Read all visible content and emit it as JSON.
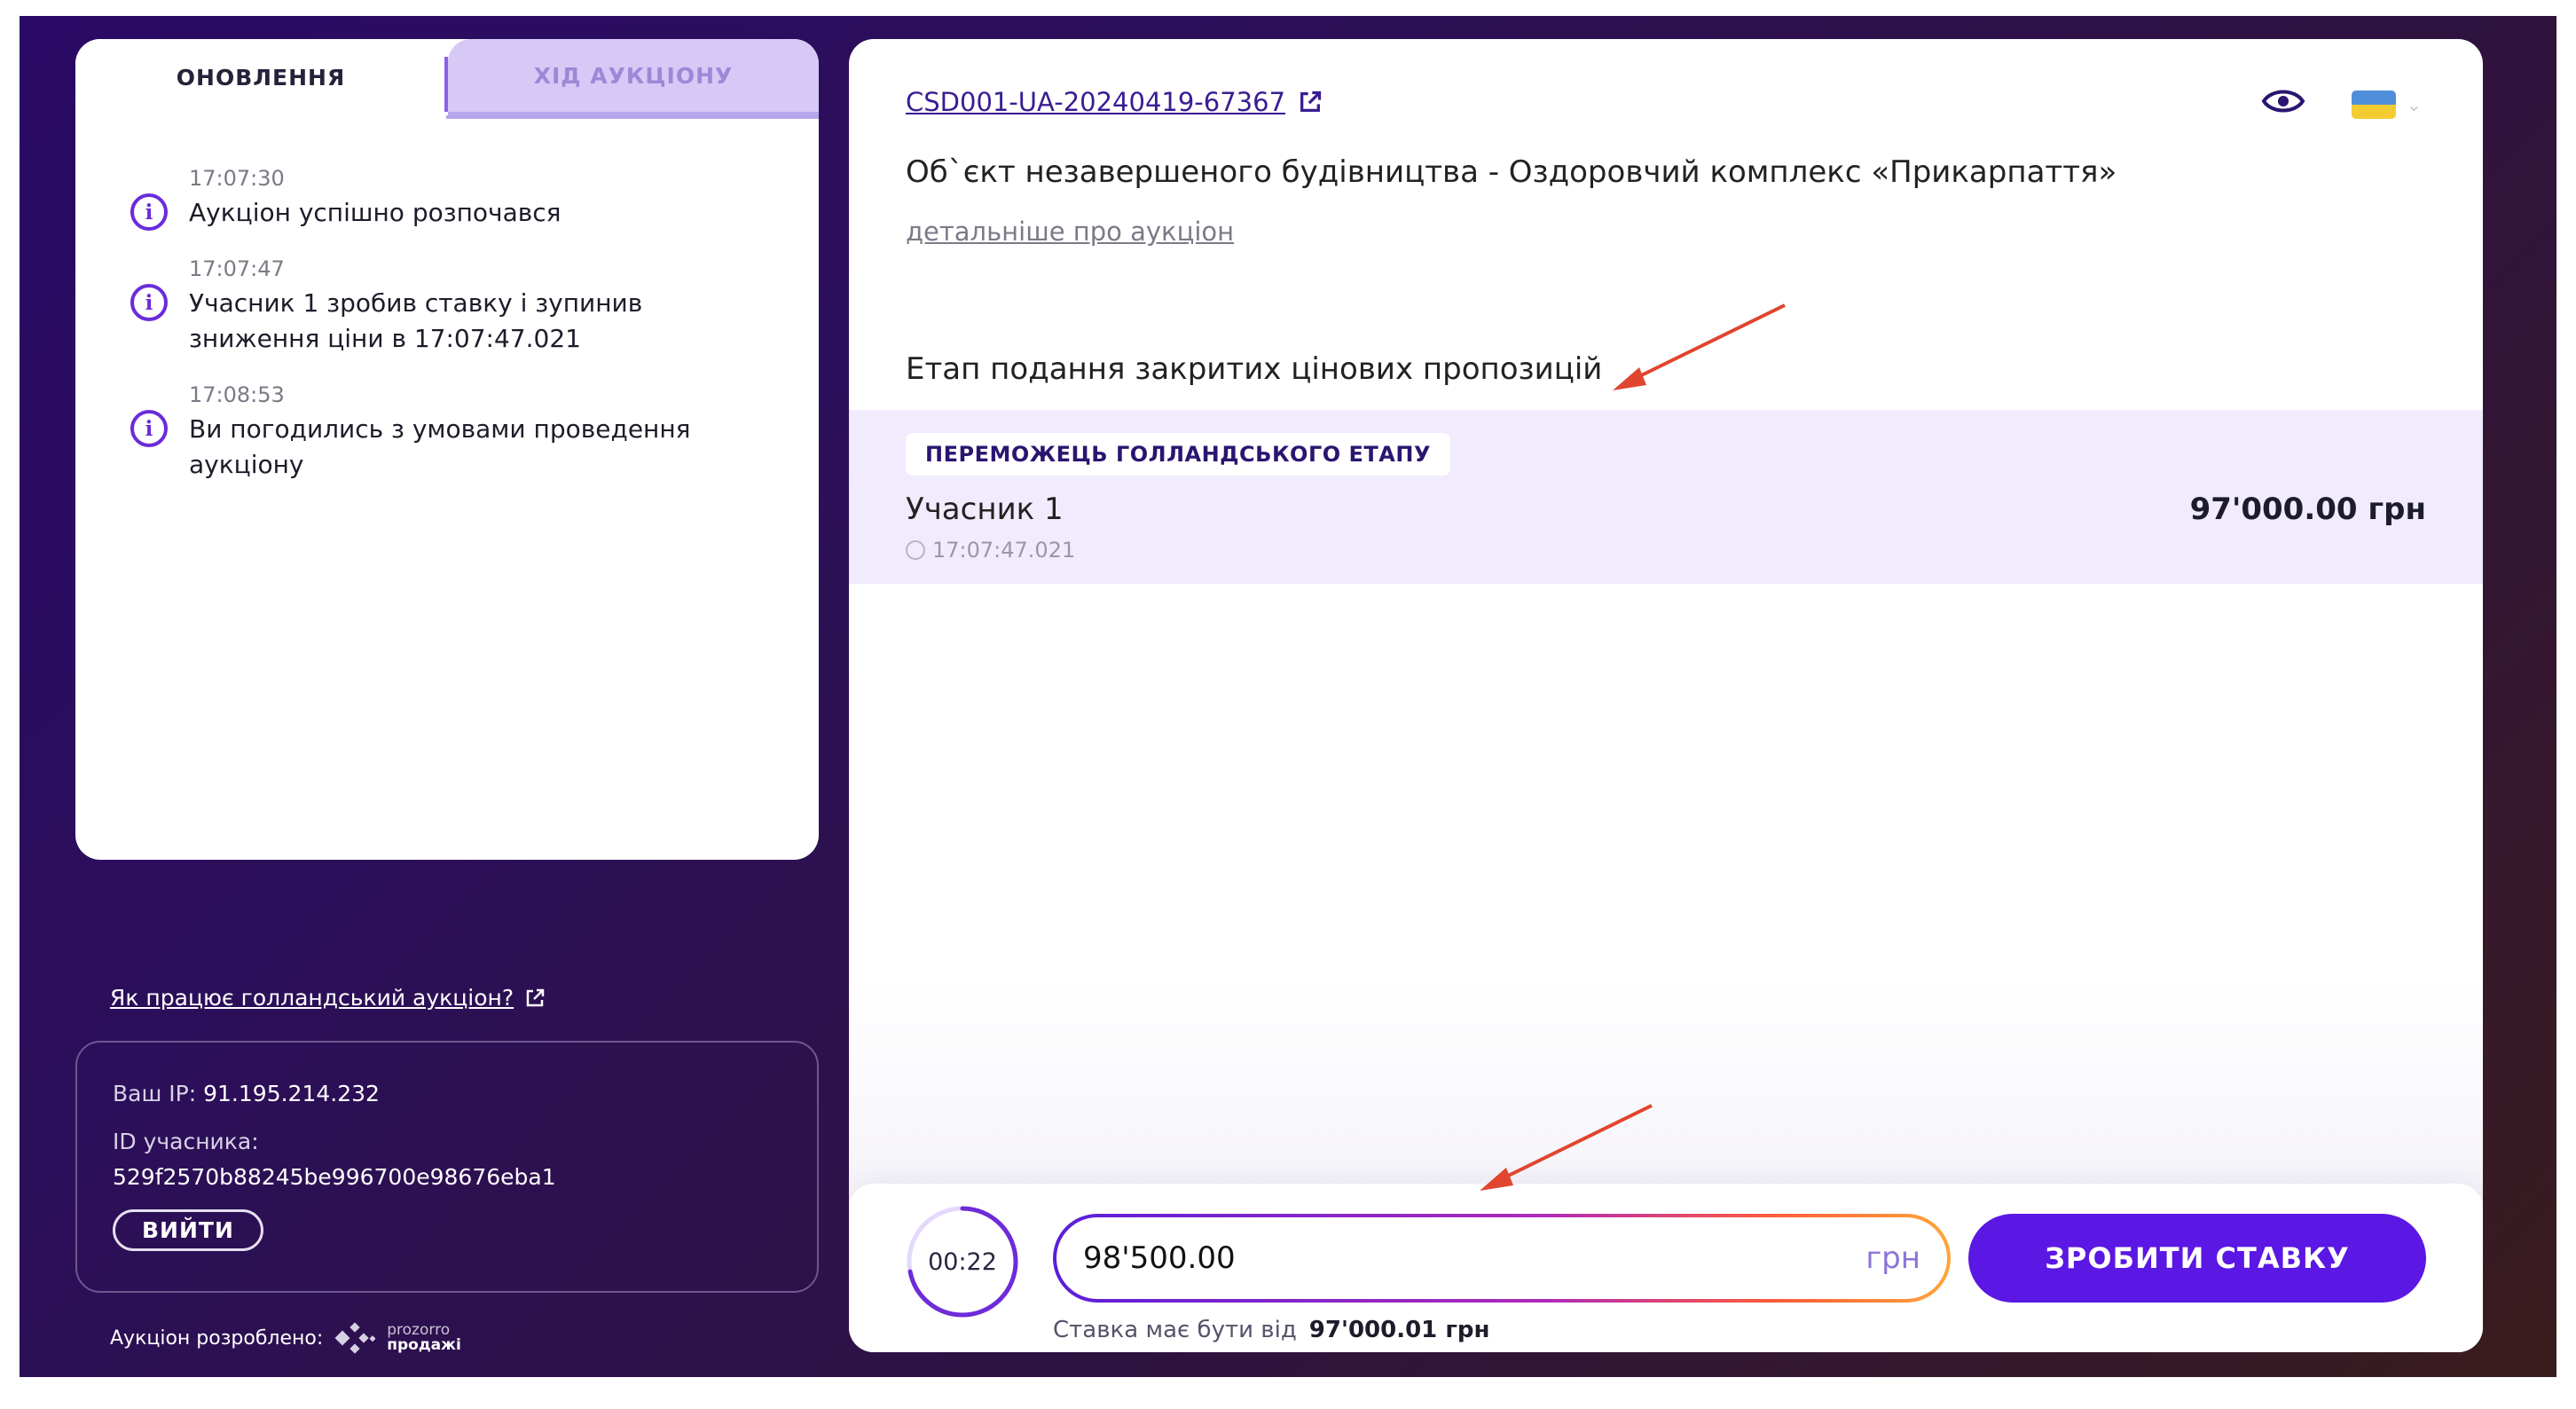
{
  "tabs": {
    "updates_label": "ОНОВЛЕННЯ",
    "progress_label": "ХІД АУКЦІОНУ"
  },
  "events": [
    {
      "time": "17:07:30",
      "message": "Аукціон успішно розпочався"
    },
    {
      "time": "17:07:47",
      "message": "Учасник 1 зробив ставку і зупинив зниження ціни в 17:07:47.021"
    },
    {
      "time": "17:08:53",
      "message": "Ви погодились з умовами проведення аукціону"
    }
  ],
  "info_icon_glyph": "i",
  "sidebar": {
    "how_link": "Як працює голландський аукціон?",
    "ip_label": "Ваш IP:",
    "ip_value": "91.195.214.232",
    "participant_label": "ID учасника:",
    "participant_id": "529f2570b88245be996700e98676eba1",
    "logout_label": "ВИЙТИ",
    "developed_by": "Аукціон розроблено:",
    "logo_top": "prozorro",
    "logo_bottom": "продажі"
  },
  "auction": {
    "id": "CSD001-UA-20240419-67367",
    "title": "Об`єкт незавершеного будівництва - Оздоровчий комплекс «Прикарпаття»",
    "more_link": "детальніше про аукціон",
    "stage_title": "Етап подання закритих цінових пропозицій"
  },
  "winner": {
    "badge": "ПЕРЕМОЖЕЦЬ ГОЛЛАНДСЬКОГО ЕТАПУ",
    "name": "Учасник 1",
    "time": "17:07:47.021",
    "amount": "97'000.00 грн"
  },
  "bid": {
    "timer": "00:22",
    "timer_progress": 0.72,
    "value": "98'500.00",
    "unit": "грн",
    "button": "ЗРОБИТИ СТАВКУ",
    "hint_prefix": "Ставка має бути від",
    "hint_min": "97'000.01 грн"
  },
  "icons": {
    "info": "info-circle-icon",
    "external": "external-link-icon",
    "eye": "eye-icon",
    "flag": "ukraine-flag-icon",
    "clock": "clock-icon"
  },
  "colors": {
    "accent": "#5b17e3",
    "tab_active_bg": "#d6c9f6",
    "winner_band": "#f1ebfd",
    "annotation_arrow": "#e0452f"
  }
}
